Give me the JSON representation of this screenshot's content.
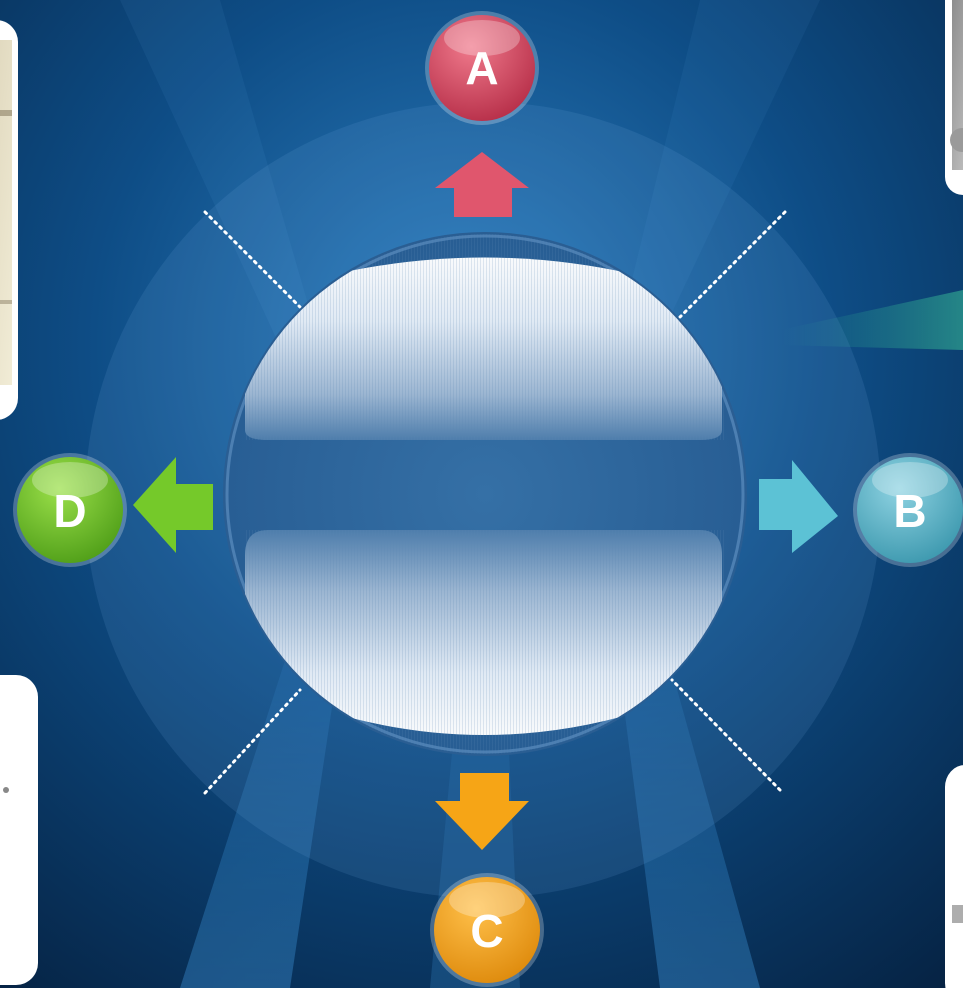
{
  "diagram": {
    "nodes": [
      {
        "id": "top",
        "label": "A",
        "color": "#d2475f"
      },
      {
        "id": "right",
        "label": "B",
        "color": "#56b6cb"
      },
      {
        "id": "bottom",
        "label": "C",
        "color": "#f2a11a"
      },
      {
        "id": "left",
        "label": "D",
        "color": "#6cc02a"
      }
    ],
    "center": {
      "color": "#2e6aa3"
    },
    "colors": {
      "background": "#0a2d56",
      "arrow_top": "#e0566d",
      "arrow_right": "#5cc2d5",
      "arrow_bottom": "#f6a516",
      "arrow_left": "#75c92a"
    },
    "corner_photos": [
      "top-left",
      "top-right",
      "bottom-left",
      "bottom-right"
    ]
  }
}
